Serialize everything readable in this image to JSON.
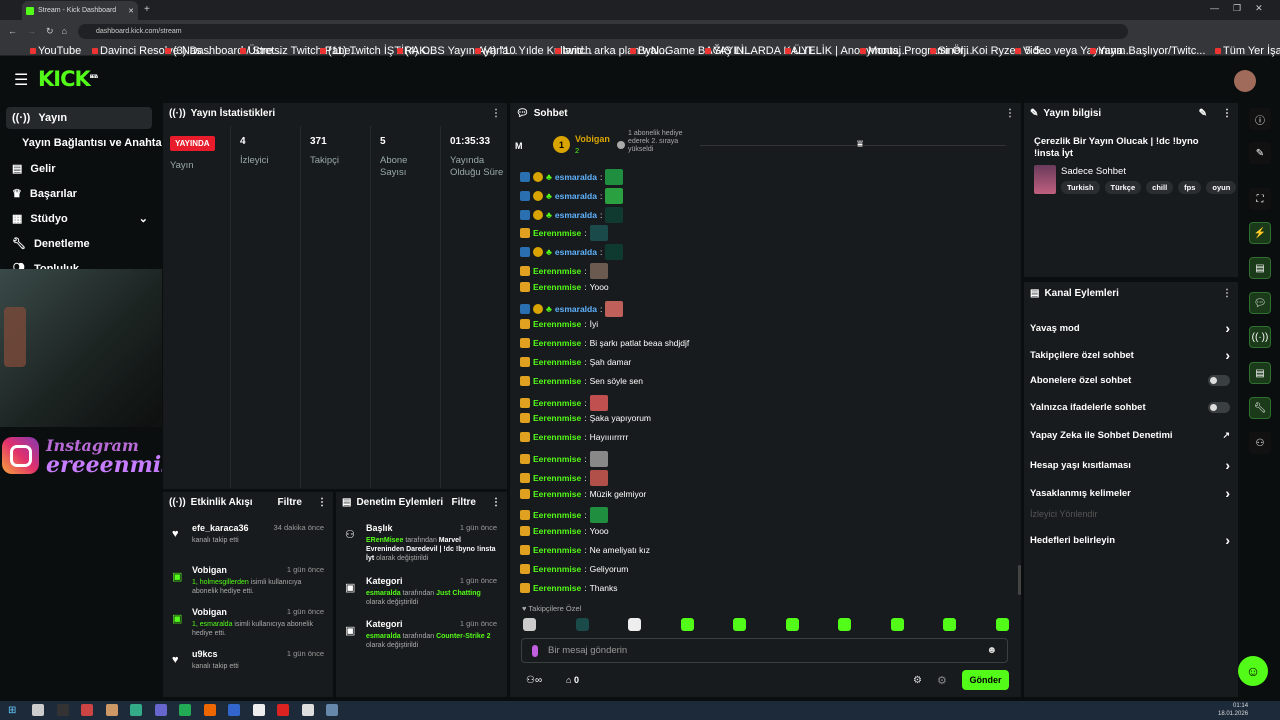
{
  "browser": {
    "tab_title": "Stream - Kick Dashboard",
    "url": "dashboard.kick.com/stream",
    "bookmarks": [
      "YouTube",
      "Davinci Resolve Nas...",
      "(3) Dashboard / Stre...",
      "Ücretsiz Twitch Pane...",
      "(11) Twitch İŞTİRAK...",
      "(4) OBS Yayın Ayarla...",
      "(4) \"10 Yılde Kulland...",
      "twitch arka plan wal...",
      "ByNoGame BAĞIŞ Lİ...",
      "YAYINLARDA KALIT...",
      "ÜYELİK | Anonymous...",
      "Montaj Programı Öl...",
      "Sinerji Koi Ryzen 5 5...",
      "Video veya Yayınına...",
      "Yayın Başlıyor/Twitc...",
      "Tüm Yer İşaretleri"
    ]
  },
  "header": {
    "logo": "KICK",
    "beta": "BETA"
  },
  "sidebar": {
    "items": [
      "Yayın",
      "Yayın Bağlantısı ve Anahtarı",
      "Gelir",
      "Başarılar",
      "Stüdyo",
      "Denetleme",
      "Topluluk"
    ]
  },
  "overlay": {
    "instagram_title": "Instagram",
    "instagram_handle": "ereeenmise"
  },
  "stats": {
    "title": "Yayın İstatistikleri",
    "live_badge": "YAYINDA",
    "live_label": "Yayın",
    "cols": [
      {
        "value": "4",
        "label": "İzleyici"
      },
      {
        "value": "371",
        "label": "Takipçi"
      },
      {
        "value": "5",
        "label": "Abone Sayısı"
      },
      {
        "value": "01:35:33",
        "label": "Yayında Olduğu Süre"
      }
    ]
  },
  "activity": {
    "title": "Etkinlik Akışı",
    "filter": "Filtre",
    "items": [
      {
        "name": "efe_karaca36",
        "time": "34 dakika önce",
        "desc": "kanalı takip etti"
      },
      {
        "name": "Vobigan",
        "time": "1 gün önce",
        "desc_hl": "1, holmesgillerden",
        "desc": "isimli kullanıcıya abonelik hediye etti."
      },
      {
        "name": "Vobigan",
        "time": "1 gün önce",
        "desc_hl": "1, esmaralda",
        "desc": "isimli kullanıcıya abonelik hediye etti."
      },
      {
        "name": "u9kcs",
        "time": "1 gün önce",
        "desc": "kanalı takip etti"
      }
    ]
  },
  "moderation": {
    "title": "Denetim Eylemleri",
    "filter": "Filtre",
    "items": [
      {
        "name": "Başlık",
        "time": "1 gün önce",
        "by": "ERenMisee",
        "mid": "tarafından",
        "val": "Marvel Evreninden Daredevil | !dc !byno !insta İyt",
        "end": "olarak değiştirildi"
      },
      {
        "name": "Kategori",
        "time": "1 gün önce",
        "by": "esmaralda",
        "mid": "tarafından",
        "val": "Just Chatting",
        "end": "olarak değiştirildi"
      },
      {
        "name": "Kategori",
        "time": "1 gün önce",
        "by": "esmaralda",
        "mid": "tarafından",
        "val": "Counter-Strike 2",
        "end": "olarak değiştirildi"
      }
    ]
  },
  "chat": {
    "title": "Sohbet",
    "pinned_user": "Vobigan",
    "pinned_count": "2",
    "pinned_text": "1 abonelik hediye ederek 2. sıraya yükseldi",
    "m_label": "M",
    "messages": [
      {
        "user": "esmaralda",
        "text": "",
        "type": "b"
      },
      {
        "user": "esmaralda",
        "text": "",
        "type": "b"
      },
      {
        "user": "esmaralda",
        "text": "",
        "type": "b"
      },
      {
        "user": "Eerennmise",
        "text": "",
        "type": "g"
      },
      {
        "user": "esmaralda",
        "text": "",
        "type": "b"
      },
      {
        "user": "Eerennmise",
        "text": "",
        "type": "g"
      },
      {
        "user": "Eerennmise",
        "text": "Yooo",
        "type": "g"
      },
      {
        "user": "esmaralda",
        "text": "",
        "type": "b"
      },
      {
        "user": "Eerennmise",
        "text": "İyi",
        "type": "g"
      },
      {
        "user": "Eerennmise",
        "text": "Bi şarkı patlat beaa shdjdjf",
        "type": "g"
      },
      {
        "user": "Eerennmise",
        "text": "Şah damar",
        "type": "g"
      },
      {
        "user": "Eerennmise",
        "text": "Sen söyle sen",
        "type": "g"
      },
      {
        "user": "Eerennmise",
        "text": "",
        "type": "g"
      },
      {
        "user": "Eerennmise",
        "text": "Şaka yapıyorum",
        "type": "g"
      },
      {
        "user": "Eerennmise",
        "text": "Hayıııırrrrr",
        "type": "g"
      },
      {
        "user": "Eerennmise",
        "text": "",
        "type": "g"
      },
      {
        "user": "Eerennmise",
        "text": "",
        "type": "g"
      },
      {
        "user": "Eerennmise",
        "text": "Müzik gelmiyor",
        "type": "g"
      },
      {
        "user": "Eerennmise",
        "text": "",
        "type": "g"
      },
      {
        "user": "Eerennmise",
        "text": "Yooo",
        "type": "g"
      },
      {
        "user": "Eerennmise",
        "text": "Ne ameliyatı kız",
        "type": "g"
      },
      {
        "user": "Eerennmise",
        "text": "Geliyorum",
        "type": "g"
      },
      {
        "user": "Eerennmise",
        "text": "Thanks",
        "type": "g"
      }
    ],
    "followers_only": "Takipçilere Özel",
    "input_placeholder": "Bir mesaj gönderin",
    "send": "Gönder",
    "points": "0"
  },
  "stream_info": {
    "title": "Yayın bilgisi",
    "stream_title": "Çerezlik Bir Yayın Olucak | !dc !byno !insta İyt",
    "category": "Sadece Sohbet",
    "tags": [
      "Turkish",
      "Türkçe",
      "chill",
      "fps",
      "oyun"
    ]
  },
  "channel_actions": {
    "title": "Kanal Eylemleri",
    "items": [
      {
        "label": "Yavaş mod",
        "kind": "chev"
      },
      {
        "label": "Takipçilere özel sohbet",
        "kind": "chev"
      },
      {
        "label": "Abonelere özel sohbet",
        "kind": "toggle"
      },
      {
        "label": "Yalnızca ifadelerle sohbet",
        "kind": "toggle"
      },
      {
        "label": "Yapay Zeka ile Sohbet Denetimi",
        "kind": "ext"
      },
      {
        "label": "Hesap yaşı kısıtlaması",
        "kind": "chev"
      },
      {
        "label": "Yasaklanmış kelimeler",
        "kind": "chev"
      },
      {
        "label": "İzleyici Yönlendir",
        "kind": "disabled"
      },
      {
        "label": "Hedefleri belirleyin",
        "kind": "chev"
      }
    ]
  },
  "taskbar": {
    "time": "01:14",
    "date": "18.01.2026"
  },
  "colors": {
    "accent": "#53fc18",
    "live": "#e81c2b",
    "blue": "#5fb3ff"
  }
}
